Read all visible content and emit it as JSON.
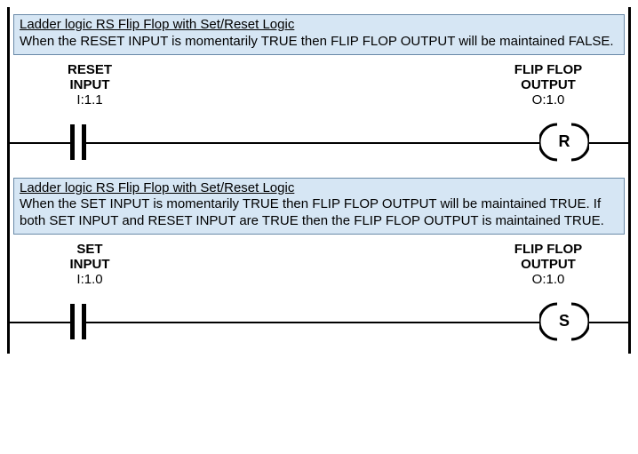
{
  "rung1": {
    "comment_title": "Ladder logic RS Flip Flop with Set/Reset Logic",
    "comment_body": "When the RESET INPUT is momentarily TRUE then FLIP FLOP OUTPUT will be maintained FALSE.",
    "input": {
      "label_line1": "RESET",
      "label_line2": "INPUT",
      "address": "I:1.1"
    },
    "output": {
      "label_line1": "FLIP FLOP",
      "label_line2": "OUTPUT",
      "address": "O:1.0",
      "coil_letter": "R"
    }
  },
  "rung2": {
    "comment_title": "Ladder logic RS Flip Flop with Set/Reset Logic",
    "comment_body": "When the SET INPUT is momentarily TRUE then FLIP FLOP OUTPUT will be maintained TRUE. If both SET INPUT and RESET INPUT are TRUE then the FLIP FLOP OUTPUT is maintained TRUE.",
    "input": {
      "label_line1": "SET",
      "label_line2": "INPUT",
      "address": "I:1.0"
    },
    "output": {
      "label_line1": "FLIP FLOP",
      "label_line2": "OUTPUT",
      "address": "O:1.0",
      "coil_letter": "S"
    }
  }
}
